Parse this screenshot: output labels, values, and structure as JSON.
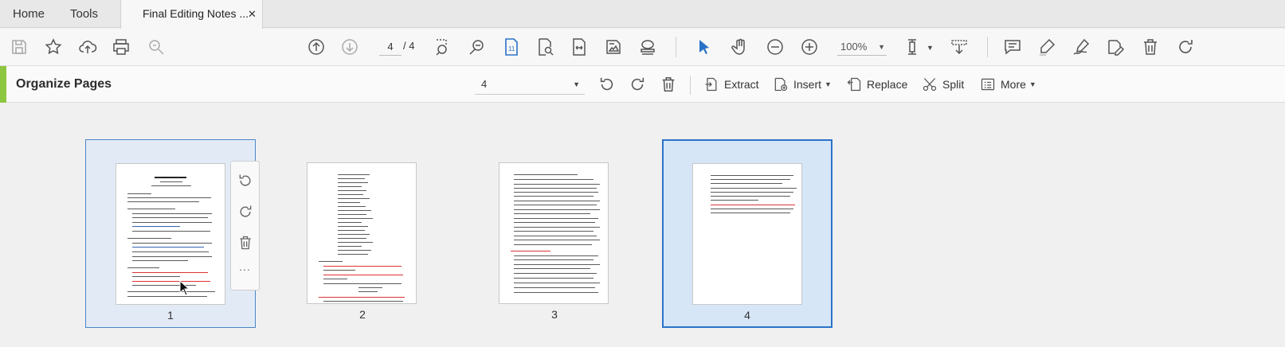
{
  "tabs": {
    "home": "Home",
    "tools": "Tools",
    "document": "Final Editing Notes ...",
    "close": "✕"
  },
  "toolbar": {
    "icons": [
      "save-icon",
      "bookmark-star-icon",
      "cloud-upload-icon",
      "print-icon",
      "zoom-search-icon",
      "page-up-icon",
      "page-down-icon",
      "marquee-zoom-icon",
      "zoom-out-search-icon",
      "single-page-icon",
      "page-zoom-icon",
      "fit-width-icon",
      "image-page-icon",
      "stamp-icon",
      "select-arrow-icon",
      "hand-tool-icon",
      "zoom-out-icon",
      "zoom-in-icon",
      "page-layout-icon",
      "download-icon",
      "comment-icon",
      "highlight-icon",
      "sign-icon",
      "edit-pdf-icon",
      "delete-icon",
      "redo-icon"
    ],
    "current_page": "4",
    "total_pages": "/ 4",
    "zoom": "100%"
  },
  "organize": {
    "title": "Organize Pages",
    "range_value": "4",
    "extract": "Extract",
    "insert": "Insert",
    "replace": "Replace",
    "split": "Split",
    "more": "More"
  },
  "pages": [
    {
      "number": "1",
      "state": "selected"
    },
    {
      "number": "2",
      "state": "normal"
    },
    {
      "number": "3",
      "state": "normal"
    },
    {
      "number": "4",
      "state": "active"
    }
  ],
  "page_actions": {
    "more": "..."
  },
  "colors": {
    "accent_green": "#8dc63f",
    "selection_blue": "#2a72c8",
    "icon_gray": "#555555"
  }
}
